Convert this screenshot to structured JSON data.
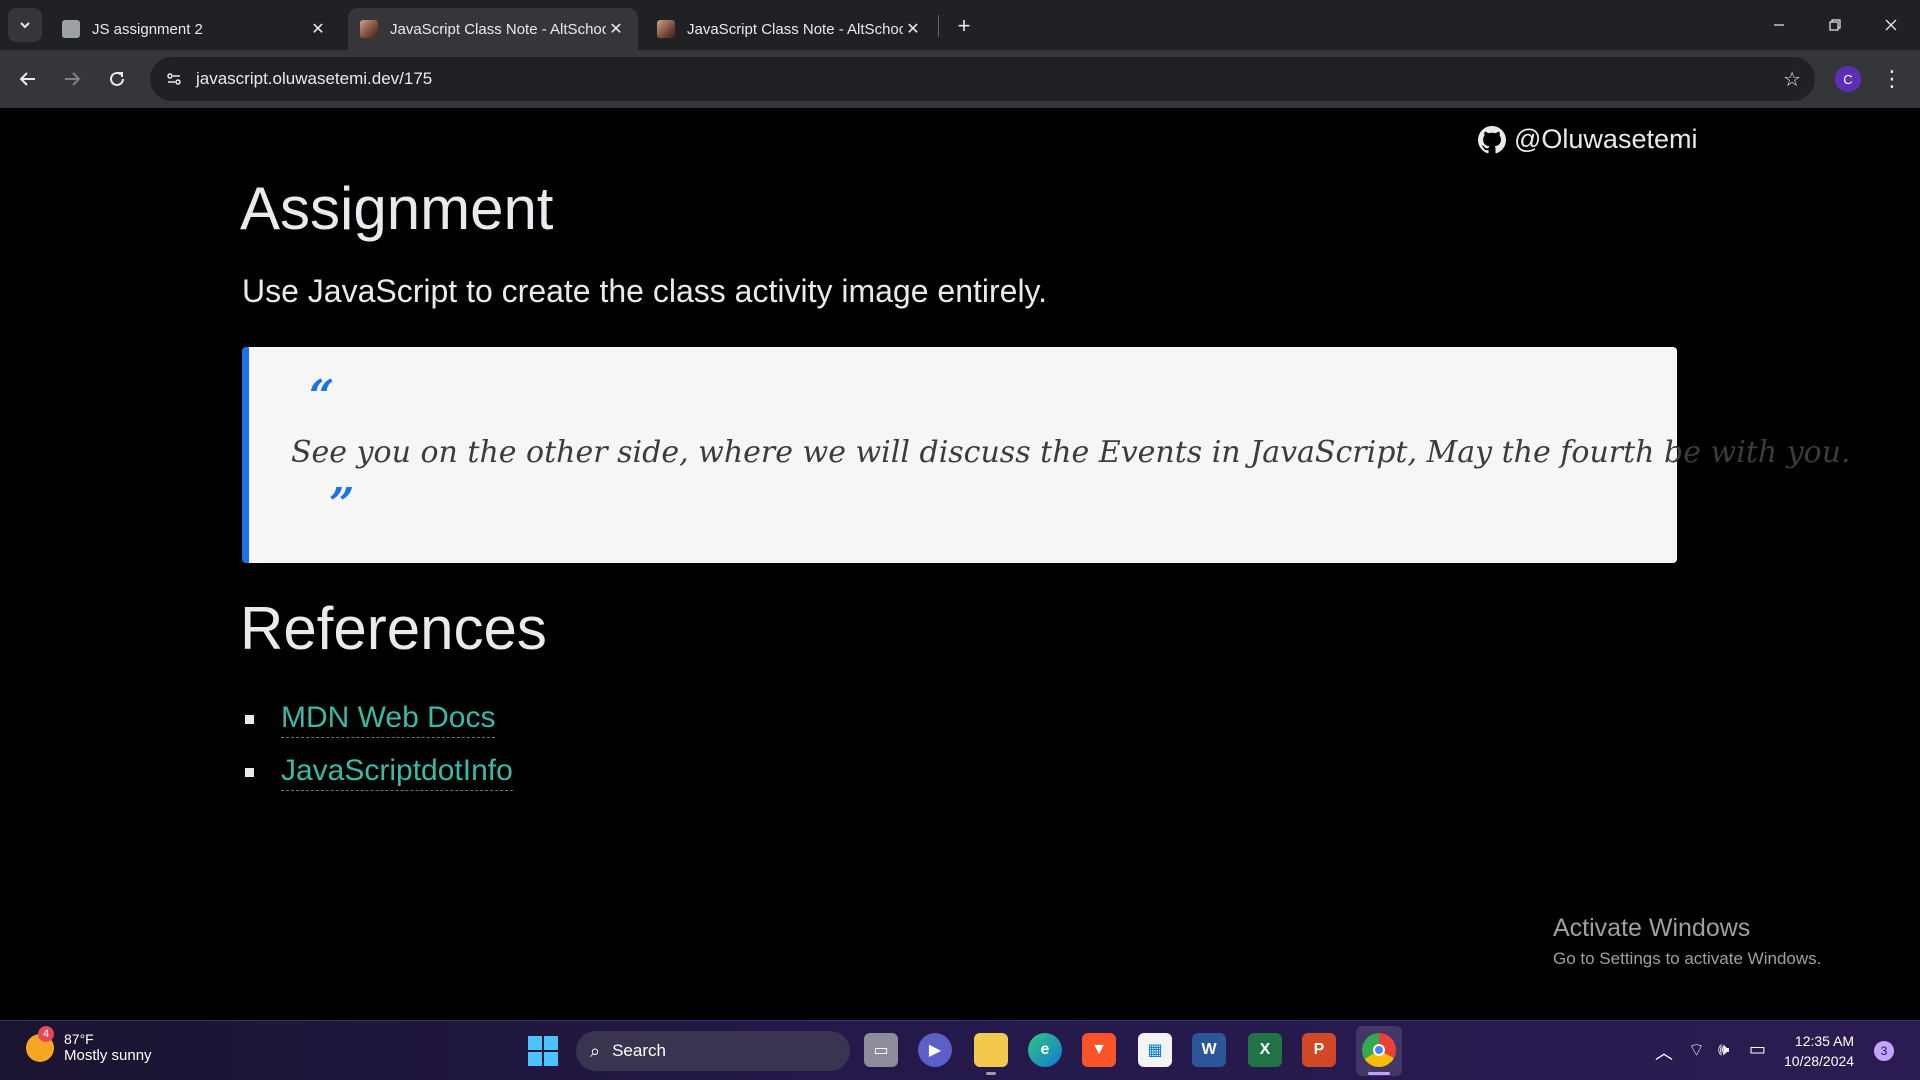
{
  "browser": {
    "tabs": [
      {
        "title": "JS assignment 2",
        "active": false
      },
      {
        "title": "JavaScript Class Note - AltSchool",
        "active": true
      },
      {
        "title": "JavaScript Class Note - AltSchool",
        "active": false
      }
    ],
    "url": "javascript.oluwasetemi.dev/175",
    "profile_initial": "C",
    "icons": [
      "tab-search-icon",
      "back-icon",
      "forward-icon",
      "reload-icon",
      "site-info-icon",
      "bookmark-star-icon",
      "menu-kebab-icon",
      "minimize-icon",
      "restore-icon",
      "close-icon"
    ]
  },
  "page": {
    "github_handle": "@Oluwasetemi",
    "assignment_heading": "Assignment",
    "assignment_text": "Use JavaScript to create the class activity image entirely.",
    "quote": {
      "open_mark": "“",
      "text": "See you on the other side, where we will discuss the Events in JavaScript, May the fourth be with you.",
      "close_mark": "”",
      "accent_color": "#1a73e8"
    },
    "references_heading": "References",
    "references": [
      {
        "label": "MDN Web Docs"
      },
      {
        "label": "JavaScriptdotInfo"
      }
    ],
    "link_color": "#3bb9a6"
  },
  "watermark": {
    "title": "Activate Windows",
    "subtitle": "Go to Settings to activate Windows."
  },
  "taskbar": {
    "weather_temp": "87°F",
    "weather_desc": "Mostly sunny",
    "weather_badge": "4",
    "search_label": "Search",
    "apps": [
      "task-view",
      "teams-meet",
      "file-explorer",
      "edge",
      "brave",
      "microsoft-store",
      "word",
      "excel",
      "powerpoint",
      "chrome"
    ],
    "time": "12:35 AM",
    "date": "10/28/2024",
    "notification_count": "3"
  }
}
